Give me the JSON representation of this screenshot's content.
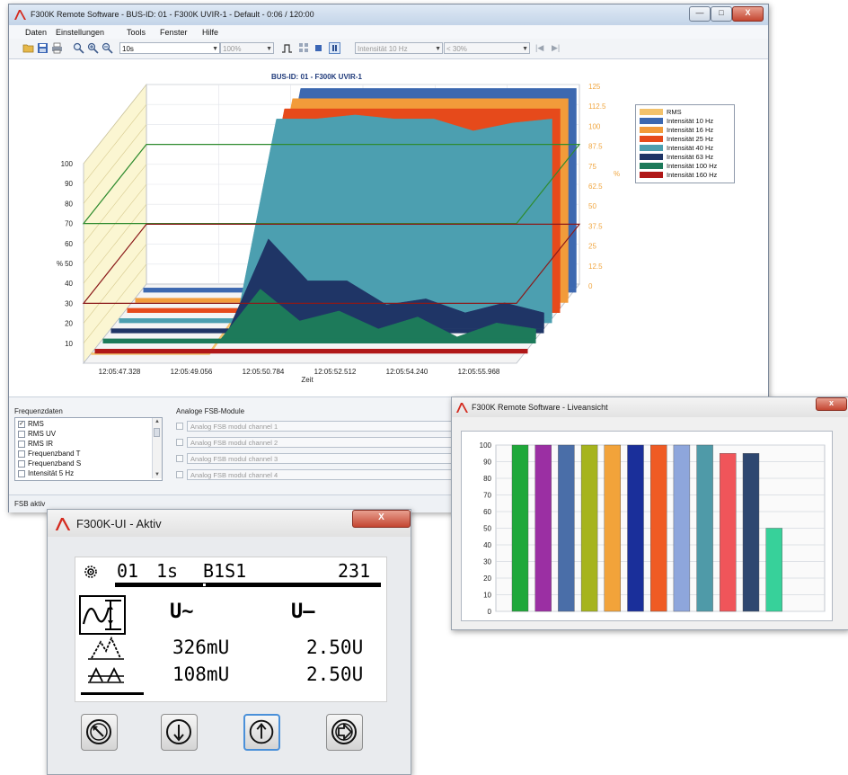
{
  "main_window": {
    "title": "F300K Remote Software - BUS-ID: 01 - F300K UVIR-1 - Default - 0:06 / 120:00",
    "menu": [
      "Daten",
      "Einstellungen",
      "Tools",
      "Fenster",
      "Hilfe"
    ],
    "toolbar": {
      "time_range_value": "10s",
      "zoom_value": "100%",
      "intensity_select": "Intensität 10 Hz",
      "threshold_select": "< 30%"
    },
    "chart_title": "BUS-ID: 01 - F300K UVIR-1",
    "status_text": "FSB aktiv"
  },
  "chart_data": [
    {
      "type": "area",
      "title": "BUS-ID: 01 - F300K UVIR-1",
      "xlabel": "Zeit",
      "ylabel": "%",
      "y2label": "%",
      "x_ticks": [
        "12:05:47.328",
        "12:05:49.056",
        "12:05:50.784",
        "12:05:52.512",
        "12:05:54.240",
        "12:05:55.968"
      ],
      "y_ticks": [
        10,
        20,
        30,
        40,
        50,
        60,
        70,
        80,
        90,
        100
      ],
      "y2_ticks": [
        "0",
        "12.5",
        "25",
        "37.5",
        "50",
        "62.5",
        "75",
        "87.5",
        "100",
        "112.5",
        "125"
      ],
      "ylim": [
        0,
        125
      ],
      "legend_position": "right",
      "grid": true,
      "series": [
        {
          "name": "RMS",
          "color": "#f3c26b",
          "values": [
            0,
            0,
            0,
            0,
            28,
            30,
            30,
            30,
            30,
            30,
            30,
            29
          ]
        },
        {
          "name": "Intensität 10 Hz",
          "color": "#3c68b0",
          "values": [
            0,
            0,
            0,
            0,
            100,
            100,
            100,
            100,
            100,
            100,
            100,
            100
          ]
        },
        {
          "name": "Intensität 16 Hz",
          "color": "#f29b3a",
          "values": [
            0,
            0,
            0,
            0,
            100,
            100,
            100,
            100,
            100,
            100,
            100,
            100
          ]
        },
        {
          "name": "Intensität 25 Hz",
          "color": "#e64a1b",
          "values": [
            0,
            0,
            0,
            0,
            100,
            100,
            100,
            100,
            100,
            100,
            100,
            100
          ]
        },
        {
          "name": "Intensität 40 Hz",
          "color": "#4c9fb0",
          "values": [
            0,
            0,
            0,
            0,
            100,
            100,
            98,
            100,
            95,
            98,
            95,
            100
          ]
        },
        {
          "name": "Intensität 63 Hz",
          "color": "#1f3566",
          "values": [
            0,
            0,
            0,
            0,
            45,
            30,
            20,
            15,
            10,
            12,
            10,
            8
          ]
        },
        {
          "name": "Intensität 100 Hz",
          "color": "#1d7a5a",
          "values": [
            0,
            0,
            0,
            0,
            25,
            15,
            10,
            8,
            6,
            5,
            5,
            5
          ]
        },
        {
          "name": "Intensität 160 Hz",
          "color": "#b01818",
          "values": [
            0,
            0,
            0,
            0,
            0,
            0,
            0,
            0,
            0,
            0,
            0,
            0
          ]
        }
      ],
      "threshold_lines": [
        {
          "value": 70,
          "color": "#2e8b2e"
        },
        {
          "value": 30,
          "color": "#8b1a1a"
        }
      ]
    },
    {
      "type": "bar",
      "title": "",
      "ylim": [
        0,
        100
      ],
      "y_ticks": [
        0,
        10,
        20,
        30,
        40,
        50,
        60,
        70,
        80,
        90,
        100
      ],
      "grid": true,
      "values": [
        100,
        100,
        100,
        100,
        100,
        100,
        100,
        100,
        100,
        95,
        95,
        50
      ],
      "colors": [
        "#1fa83a",
        "#9b2fa3",
        "#4a6ea8",
        "#a6b41d",
        "#f2a33a",
        "#1a2f9a",
        "#ef5b24",
        "#8ea6dc",
        "#4f9aa8",
        "#f0555a",
        "#2e4770",
        "#37d19a"
      ]
    }
  ],
  "bottom_panel": {
    "freq_title": "Frequenzdaten",
    "freq_items": [
      {
        "label": "RMS",
        "checked": true
      },
      {
        "label": "RMS UV",
        "checked": false
      },
      {
        "label": "RMS IR",
        "checked": false
      },
      {
        "label": "Frequenzband T",
        "checked": false
      },
      {
        "label": "Frequenzband S",
        "checked": false
      },
      {
        "label": "Intensität 5 Hz",
        "checked": false
      }
    ],
    "fsb_title": "Analoge FSB-Module",
    "fsb_items": [
      "Analog FSB modul channel 1",
      "Analog FSB modul channel 2",
      "Analog FSB modul channel 3",
      "Analog FSB modul channel 4"
    ]
  },
  "live_window": {
    "title": "F300K Remote Software - Liveansicht"
  },
  "ui_window": {
    "title": "F300K-UI - Aktiv",
    "lcd": {
      "id": "01",
      "interval": "1s",
      "mode": "B1S1",
      "value": "231",
      "col1_header": "U~",
      "col2_header": "U—",
      "row1_col1": "326mU",
      "row1_col2": "2.50U",
      "row2_col1": "108mU",
      "row2_col2": "2.50U"
    },
    "buttons": [
      "rotate-left-icon",
      "arrow-down-icon",
      "arrow-up-icon",
      "enter-icon"
    ]
  }
}
